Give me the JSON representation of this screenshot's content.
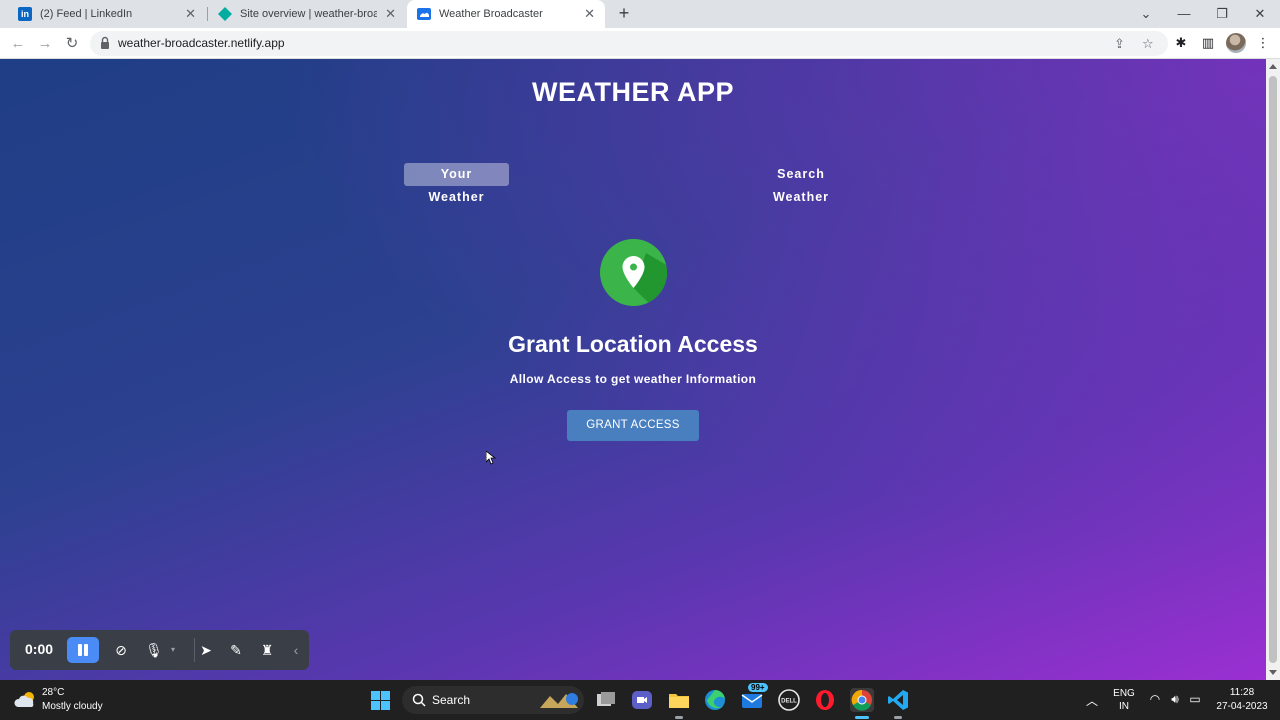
{
  "browser": {
    "tabs": [
      {
        "title": "(2) Feed | LinkedIn",
        "favicon": "linkedin-icon",
        "color": "#0a66c2"
      },
      {
        "title": "Site overview | weather-broadcaster",
        "favicon": "netlify-icon",
        "color": "#00ad9f"
      },
      {
        "title": "Weather Broadcaster",
        "favicon": "weather-icon",
        "color": "#1a73e8",
        "active": true
      }
    ],
    "url": "weather-broadcaster.netlify.app"
  },
  "page": {
    "app_title": "WEATHER APP",
    "tabs": {
      "your_weather": "Your Weather",
      "search_weather": "Search Weather"
    },
    "grant": {
      "title": "Grant Location Access",
      "subtitle": "Allow Access to get weather Information",
      "button": "GRANT ACCESS"
    },
    "icon": "location-pin-icon",
    "colors": {
      "icon_bg": "#3bb54a",
      "button_bg": "#4a7fbf",
      "gradient_start": "#1f3e85",
      "gradient_end": "#9b2fd2"
    }
  },
  "recorder": {
    "time": "0:00"
  },
  "taskbar": {
    "weather": {
      "temp": "28°C",
      "desc": "Mostly cloudy"
    },
    "search": "Search",
    "mail_badge": "99+",
    "lang": {
      "line1": "ENG",
      "line2": "IN"
    },
    "clock": {
      "time": "11:28",
      "date": "27-04-2023"
    }
  }
}
